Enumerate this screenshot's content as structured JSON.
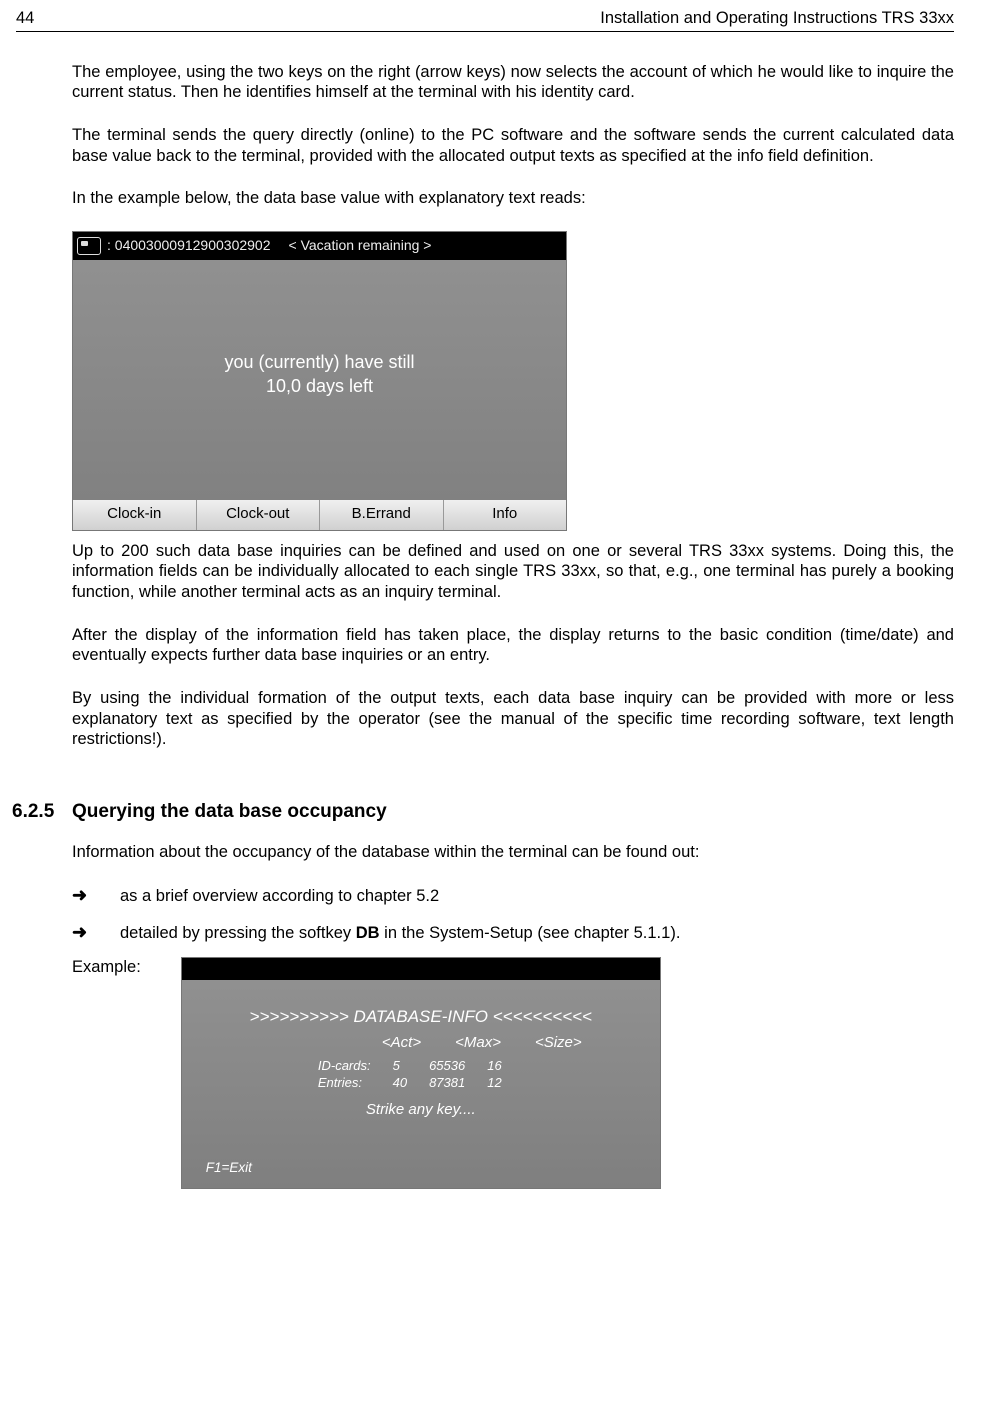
{
  "header": {
    "pageNumber": "44",
    "title": "Installation  and Operating Instructions TRS 33xx"
  },
  "paragraphs": {
    "p1": "The employee, using the two keys on the right (arrow keys) now selects the account of which he would like to inquire the current status. Then he identifies himself at the terminal with his identity card.",
    "p2": "The terminal sends the query directly (online) to the PC software and the software sends the current calculated data base value back to the terminal, provided with the allocated output texts as specified at the info field definition.",
    "p3": "In the example below, the data base value with explanatory text reads:",
    "p4": "Up to 200 such data base inquiries can be defined and used on one or several TRS 33xx systems. Doing this, the information fields can be individually allocated to each single TRS 33xx, so that, e.g., one terminal has purely a booking function, while another terminal acts as an inquiry terminal.",
    "p5": "After the display of the information field has taken place, the display returns to the basic  condition (time/date) and eventually expects further data base inquiries or an entry.",
    "p6": "By using the individual formation of the output texts, each data base inquiry can be provided with more or less explanatory text as specified by the operator (see the manual of the specific time recording software, text length restrictions!)."
  },
  "terminal1": {
    "idNumber": ": 04003000912900302902",
    "statusLabel": "<  Vacation remaining  >",
    "messageLine1": "you (currently) have still",
    "messageLine2": "10,0 days left",
    "softkeys": [
      "Clock-in",
      "Clock-out",
      "B.Errand",
      "Info"
    ]
  },
  "section": {
    "number": "6.2.5",
    "title": "Querying the data base occupancy",
    "intro": "Information about the occupancy of the database within the terminal can be found out:",
    "bullet1": "as a brief overview according to chapter 5.2",
    "bullet2a": "detailed by pressing the softkey ",
    "bullet2b": "DB",
    "bullet2c": " in the System-Setup (see chapter 5.1.1).",
    "exampleLabel": "Example:"
  },
  "terminal2": {
    "title": ">>>>>>>>>> DATABASE-INFO <<<<<<<<<<",
    "cols": [
      "<Act>",
      "<Max>",
      "<Size>"
    ],
    "rows": [
      {
        "label": "ID-cards:",
        "act": "5",
        "max": "65536",
        "size": "16"
      },
      {
        "label": "Entries:",
        "act": "40",
        "max": "87381",
        "size": "12"
      }
    ],
    "strike": "Strike any key....",
    "f1": "F1=Exit"
  }
}
